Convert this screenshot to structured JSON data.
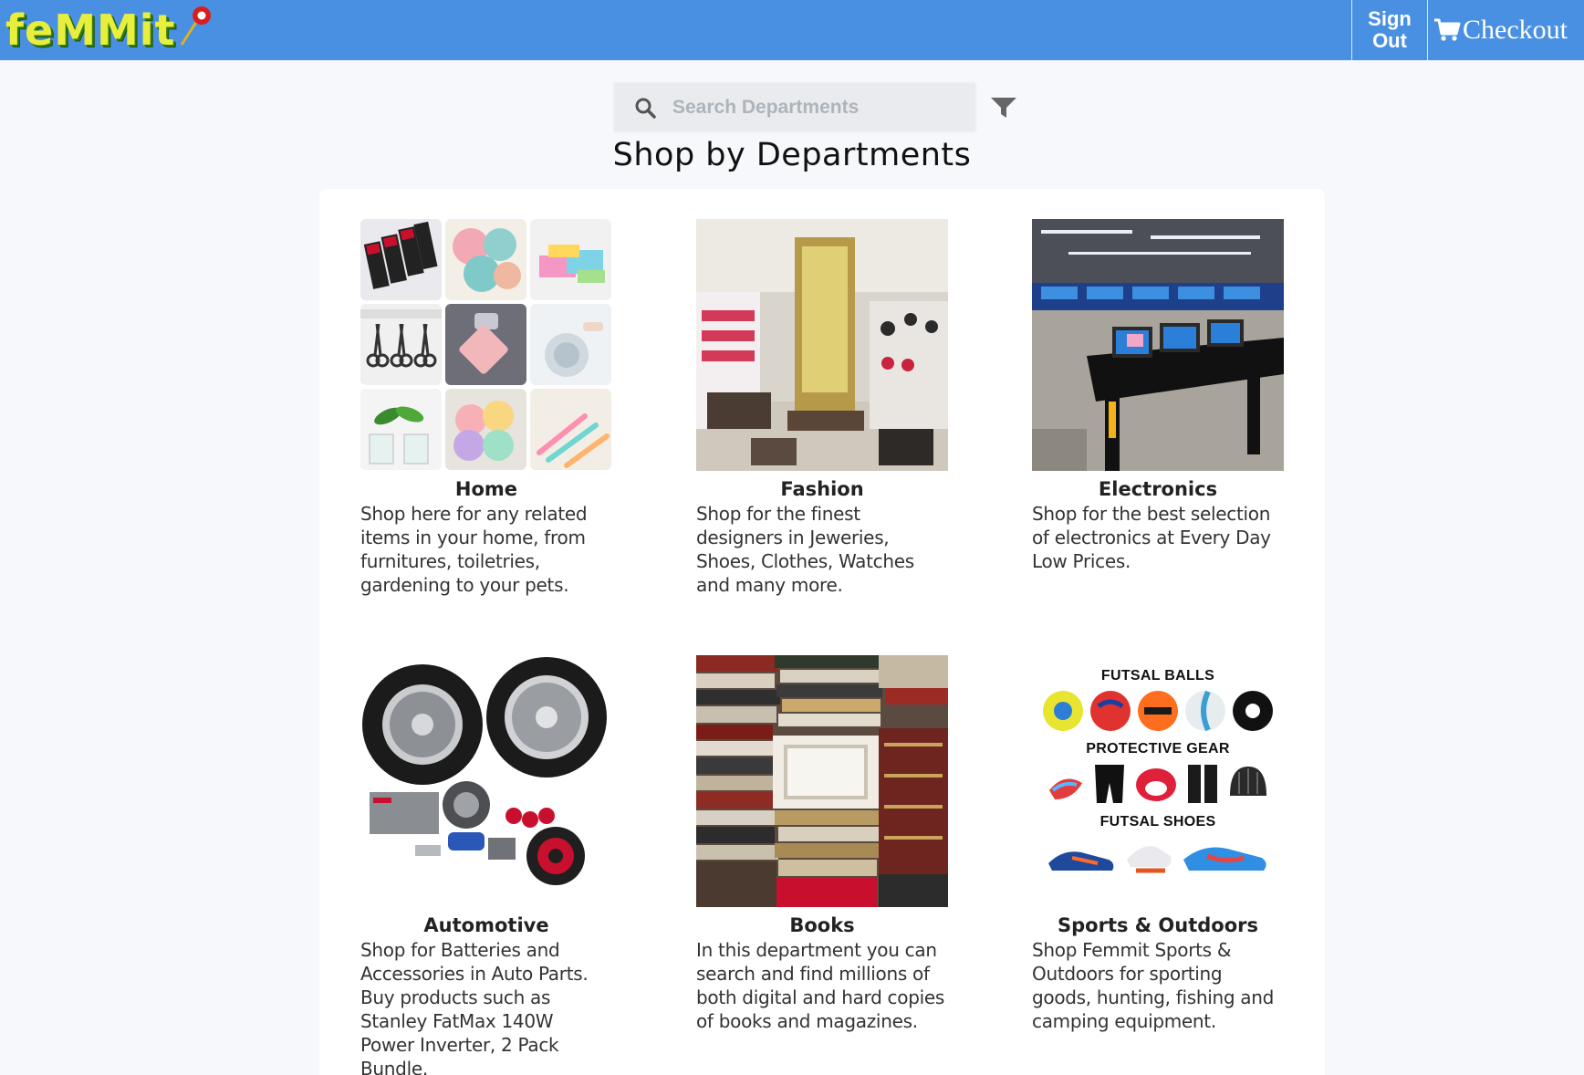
{
  "nav": {
    "logo_text": "feMMit",
    "sign_out_label_line1": "Sign",
    "sign_out_label_line2": "Out",
    "checkout_label": "Checkout",
    "colors": {
      "navbar": "#4a90e2",
      "logo": "#e7ef3c"
    }
  },
  "search": {
    "placeholder": "Search Departments",
    "value": ""
  },
  "page_title": "Shop by Departments",
  "departments": [
    {
      "name": "Home",
      "description": "Shop here for any related items in your home, from furnitures, toiletries, gardening to your pets."
    },
    {
      "name": "Fashion",
      "description": "Shop for the finest designers in Jeweries, Shoes, Clothes, Watches and many more."
    },
    {
      "name": "Electronics",
      "description": "Shop for the best selection of electronics at Every Day Low Prices."
    },
    {
      "name": "Automotive",
      "description": "Shop for Batteries and Accessories in Auto Parts. Buy products such as Stanley FatMax 140W Power Inverter, 2 Pack Bundle."
    },
    {
      "name": "Books",
      "description": "In this department you can search and find millions of both digital and hard copies of books and magazines."
    },
    {
      "name": "Sports & Outdoors",
      "description": "Shop Femmit Sports & Outdoors for sporting goods, hunting, fishing and camping equipment."
    }
  ],
  "sports_image_labels": {
    "balls": "FUTSAL BALLS",
    "gear": "PROTECTIVE GEAR",
    "shoes": "FUTSAL SHOES"
  }
}
